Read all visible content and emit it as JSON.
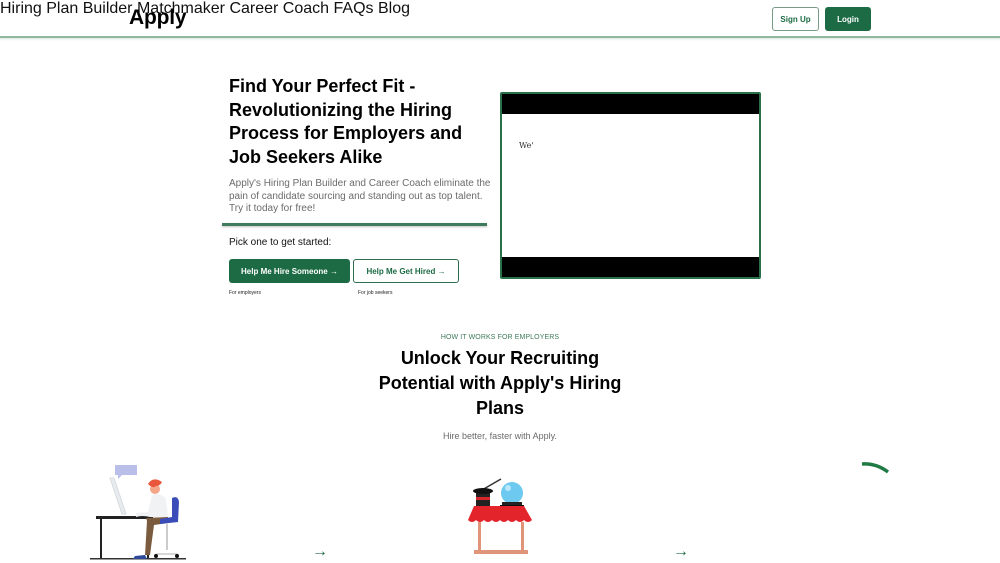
{
  "header": {
    "logo": "Apply",
    "nav": [
      {
        "label": "Hiring Plan Builder"
      },
      {
        "label": "Matchmaker"
      },
      {
        "label": "Career Coach"
      },
      {
        "label": "FAQs"
      },
      {
        "label": "Blog"
      }
    ],
    "signup_label": "Sign Up",
    "login_label": "Login"
  },
  "hero": {
    "title": "Find Your Perfect Fit - Revolutionizing the Hiring Process for Employers and Job Seekers Alike",
    "subtitle": "Apply's Hiring Plan Builder and Career Coach eliminate the pain of candidate sourcing and standing out as top talent. Try it today for free!",
    "pick_label": "Pick one to get started:",
    "hire_button": "Help Me Hire Someone →",
    "hire_caption": "For employers",
    "hired_button": "Help Me Get Hired →",
    "hired_caption": "For job seekers",
    "video_text": "We'"
  },
  "how_it_works": {
    "eyebrow": "HOW IT WORKS FOR EMPLOYERS",
    "title": "Unlock Your Recruiting Potential with Apply's Hiring Plans",
    "subtitle": "Hire better, faster with Apply.",
    "arrow_glyph": "→",
    "steps": [
      {
        "illustration": "person-at-desk-illustration"
      },
      {
        "illustration": "magic-hat-crystal-ball-illustration"
      },
      {
        "illustration": "loading-arc-illustration"
      }
    ]
  },
  "colors": {
    "brand_green": "#1d6b45",
    "header_border": "#8fb8a0"
  }
}
